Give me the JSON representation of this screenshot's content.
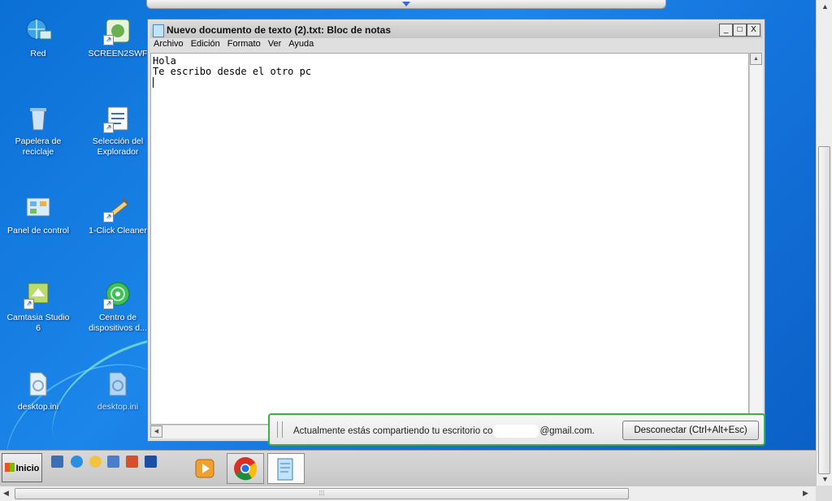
{
  "desktop": {
    "icons": [
      {
        "label": "Red",
        "icon": "network-icon"
      },
      {
        "label": "SCREEN2SWF",
        "icon": "screen2swf-icon"
      },
      {
        "label": "Papelera de reciclaje",
        "icon": "recycle-bin-icon"
      },
      {
        "label": "Selección del Explorador",
        "icon": "explorer-selection-icon"
      },
      {
        "label": "Panel de control",
        "icon": "control-panel-icon"
      },
      {
        "label": "1-Click Cleaner",
        "icon": "cleaner-icon"
      },
      {
        "label": "Camtasia Studio 6",
        "icon": "camtasia-icon"
      },
      {
        "label": "Centro de dispositivos d...",
        "icon": "device-center-icon"
      },
      {
        "label": "desktop.ini",
        "icon": "ini-file-icon"
      },
      {
        "label": "desktop.ini",
        "icon": "ini-file-icon"
      }
    ]
  },
  "notepad": {
    "title": "Nuevo documento de texto (2).txt: Bloc de notas",
    "controls": {
      "minimize": "_",
      "maximize": "□",
      "close": "X"
    },
    "menu": [
      "Archivo",
      "Edición",
      "Formato",
      "Ver",
      "Ayuda"
    ],
    "content_lines": [
      "Hola",
      "Te escribo desde el otro pc"
    ]
  },
  "share_bar": {
    "message_prefix": "Actualmente estás compartiendo tu escritorio co",
    "email_suffix": "@gmail.com.",
    "disconnect_label": "Desconectar (Ctrl+Alt+Esc)"
  },
  "taskbar": {
    "start_label": "Inicio"
  },
  "colors": {
    "desktop": "#1c86ea",
    "share_border": "#3fae49"
  }
}
